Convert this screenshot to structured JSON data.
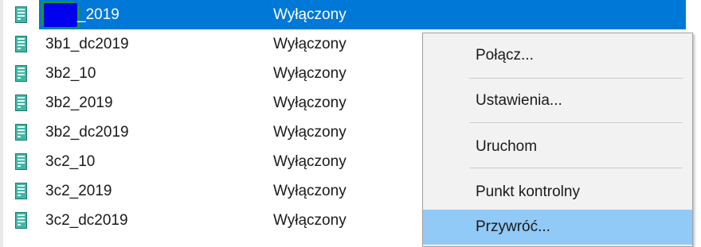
{
  "vms": [
    {
      "name": "_2019",
      "state": "Wyłączony",
      "selected": true
    },
    {
      "name": "3b1_dc2019",
      "state": "Wyłączony"
    },
    {
      "name": "3b2_10",
      "state": "Wyłączony"
    },
    {
      "name": "3b2_2019",
      "state": "Wyłączony"
    },
    {
      "name": "3b2_dc2019",
      "state": "Wyłączony"
    },
    {
      "name": "3c2_10",
      "state": "Wyłączony"
    },
    {
      "name": "3c2_2019",
      "state": "Wyłączony"
    },
    {
      "name": "3c2_dc2019",
      "state": "Wyłączony"
    }
  ],
  "context_menu": {
    "items": [
      "Połącz...",
      "Ustawienia...",
      "Uruchom",
      "Punkt kontrolny",
      "Przywróć..."
    ],
    "hovered": "Przywróć..."
  },
  "colors": {
    "selection": "#0078d7",
    "menu_hover": "#91c9f7",
    "vm_icon": "#2e9a8c"
  },
  "icons": {
    "vm": "vm-server-icon"
  }
}
